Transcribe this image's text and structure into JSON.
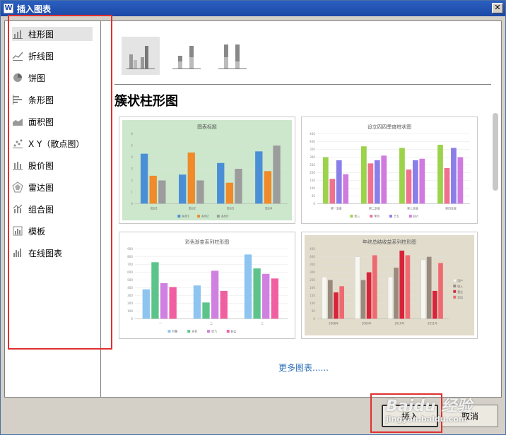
{
  "window": {
    "title": "插入图表",
    "close_glyph": "✕",
    "app_icon": "W"
  },
  "sidebar": {
    "items": [
      {
        "label": "柱形图",
        "icon": "column-chart-icon"
      },
      {
        "label": "折线图",
        "icon": "line-chart-icon"
      },
      {
        "label": "饼图",
        "icon": "pie-chart-icon"
      },
      {
        "label": "条形图",
        "icon": "bar-chart-icon"
      },
      {
        "label": "面积图",
        "icon": "area-chart-icon"
      },
      {
        "label": "X Y（散点图）",
        "icon": "scatter-chart-icon"
      },
      {
        "label": "股价图",
        "icon": "stock-chart-icon"
      },
      {
        "label": "雷达图",
        "icon": "radar-chart-icon"
      },
      {
        "label": "组合图",
        "icon": "combo-chart-icon"
      },
      {
        "label": "模板",
        "icon": "template-icon"
      },
      {
        "label": "在线图表",
        "icon": "online-chart-icon"
      }
    ],
    "selected_index": 0
  },
  "main": {
    "section_title": "簇状柱形图",
    "more_link": "更多图表......",
    "subtypes": [
      {
        "name": "clustered-column",
        "selected": true
      },
      {
        "name": "stacked-column",
        "selected": false
      },
      {
        "name": "percent-stacked-column",
        "selected": false
      }
    ]
  },
  "templates": [
    {
      "title": "图表标题",
      "background": "#cce7cc",
      "colors": [
        "#4a8fd6",
        "#f08a2a",
        "#9c9c9c"
      ],
      "categories": [
        "类别1",
        "类别2",
        "类别3",
        "类别4"
      ],
      "legend": [
        "系列1",
        "系列2",
        "系列3"
      ],
      "y_ticks": [
        "0",
        "1",
        "2",
        "3",
        "4",
        "5",
        "6"
      ]
    },
    {
      "title": "设立四四季度柱状图",
      "background": "#ffffff",
      "colors": [
        "#9bd34a",
        "#f07090",
        "#8a7ee8",
        "#d07ae0"
      ],
      "categories": [
        "第一季度",
        "第二季度",
        "第三季度",
        "第四季度"
      ],
      "legend": [
        "张三",
        "李四",
        "王五",
        "赵六"
      ],
      "y_ticks": [
        "0",
        "50",
        "100",
        "150",
        "200",
        "250",
        "300",
        "350",
        "400",
        "450"
      ]
    },
    {
      "title": "彩色渐变系列柱形图",
      "background": "#ffffff",
      "colors": [
        "#8ec4f0",
        "#5cc48a",
        "#d080e0",
        "#f060a0"
      ],
      "categories": [
        "一",
        "二",
        "三"
      ],
      "legend": [
        "刘备",
        "关羽",
        "张飞",
        "赵云"
      ],
      "y_ticks": [
        "0",
        "100",
        "200",
        "300",
        "400",
        "500",
        "600",
        "700",
        "800",
        "900"
      ]
    },
    {
      "title": "年终总结收益系列柱形图",
      "background": "#e2dccc",
      "colors": [
        "#f7f7f2",
        "#9a8a7e",
        "#d8243a",
        "#ef6a70"
      ],
      "categories": [
        "2008年",
        "2009年",
        "2010年",
        "2011年"
      ],
      "legend": [
        "用户",
        "收入",
        "营业",
        "支出"
      ],
      "y_ticks": [
        "0",
        "50",
        "100",
        "150",
        "200",
        "250",
        "300",
        "350",
        "400",
        "450"
      ]
    }
  ],
  "chart_data": [
    {
      "type": "bar",
      "title": "图表标题",
      "categories": [
        "类别1",
        "类别2",
        "类别3",
        "类别4"
      ],
      "series": [
        {
          "name": "系列1",
          "values": [
            4.3,
            2.5,
            3.5,
            4.5
          ]
        },
        {
          "name": "系列2",
          "values": [
            2.4,
            4.4,
            1.8,
            2.8
          ]
        },
        {
          "name": "系列3",
          "values": [
            2.0,
            2.0,
            3.0,
            5.0
          ]
        }
      ],
      "ylim": [
        0,
        6
      ]
    },
    {
      "type": "bar",
      "title": "设立四四季度柱状图",
      "categories": [
        "第一季度",
        "第二季度",
        "第三季度",
        "第四季度"
      ],
      "series": [
        {
          "name": "张三",
          "values": [
            300,
            370,
            360,
            380
          ]
        },
        {
          "name": "李四",
          "values": [
            160,
            260,
            220,
            230
          ]
        },
        {
          "name": "王五",
          "values": [
            280,
            280,
            280,
            360
          ]
        },
        {
          "name": "赵六",
          "values": [
            190,
            310,
            290,
            300
          ]
        }
      ],
      "ylim": [
        0,
        450
      ]
    },
    {
      "type": "bar",
      "title": "彩色渐变系列柱形图",
      "categories": [
        "一",
        "二",
        "三"
      ],
      "series": [
        {
          "name": "刘备",
          "values": [
            380,
            430,
            830
          ]
        },
        {
          "name": "关羽",
          "values": [
            730,
            210,
            650
          ]
        },
        {
          "name": "张飞",
          "values": [
            460,
            620,
            580
          ]
        },
        {
          "name": "赵云",
          "values": [
            410,
            360,
            520
          ]
        }
      ],
      "ylim": [
        0,
        900
      ]
    },
    {
      "type": "bar",
      "title": "年终总结收益系列柱形图",
      "categories": [
        "2008年",
        "2009年",
        "2010年",
        "2011年"
      ],
      "series": [
        {
          "name": "用户",
          "values": [
            270,
            400,
            270,
            380
          ]
        },
        {
          "name": "收入",
          "values": [
            250,
            250,
            330,
            400
          ]
        },
        {
          "name": "营业",
          "values": [
            170,
            300,
            440,
            180
          ]
        },
        {
          "name": "支出",
          "values": [
            210,
            410,
            410,
            360
          ]
        }
      ],
      "ylim": [
        0,
        450
      ]
    }
  ],
  "buttons": {
    "insert": "插入",
    "cancel": "取消"
  },
  "watermark": {
    "top": "Baidu 经验",
    "bottom": "jingyan.baidu.com"
  }
}
